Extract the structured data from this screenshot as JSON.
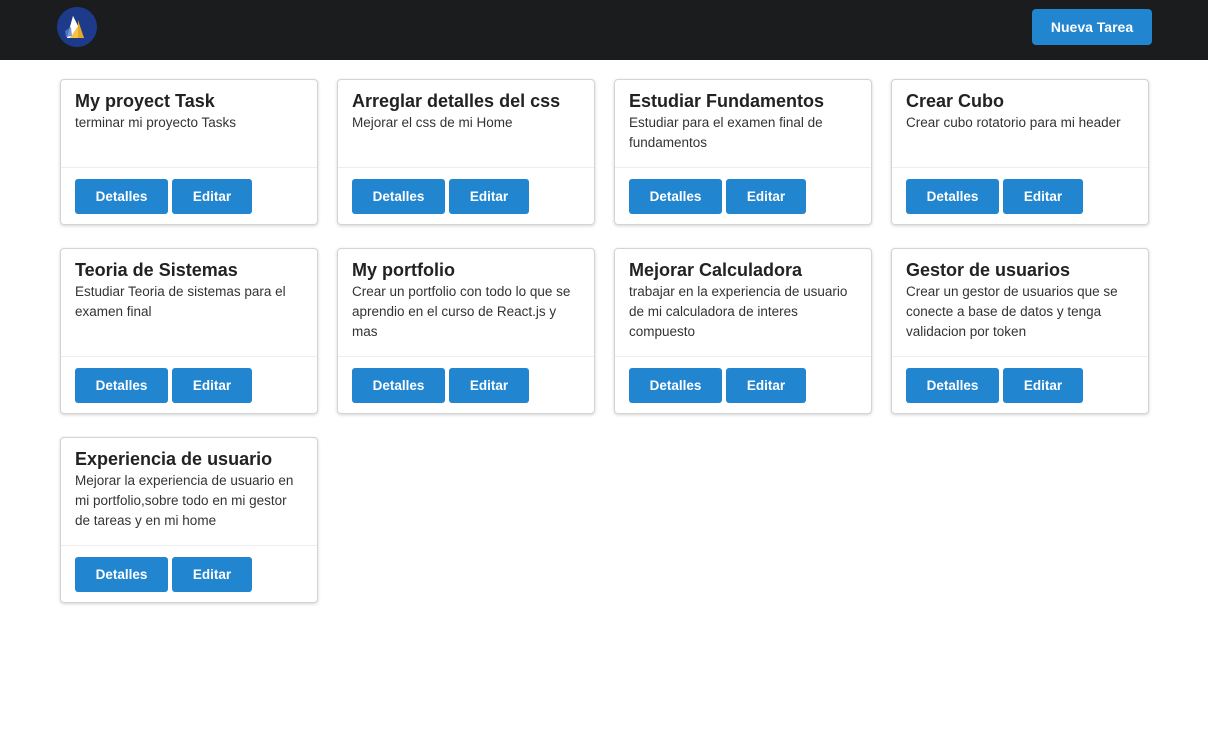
{
  "header": {
    "logo_icon": "app-logo-icon",
    "new_task_label": "Nueva Tarea",
    "background_color": "#1b1c1d",
    "accent_color": "#2185d0"
  },
  "card_actions": {
    "details_label": "Detalles",
    "edit_label": "Editar"
  },
  "tasks": [
    {
      "title": "My proyect Task",
      "description": "terminar mi proyecto Tasks"
    },
    {
      "title": "Arreglar detalles del css",
      "description": "Mejorar el css de mi Home"
    },
    {
      "title": "Estudiar Fundamentos",
      "description": "Estudiar para el examen final de fundamentos"
    },
    {
      "title": "Crear Cubo",
      "description": "Crear cubo rotatorio para mi header"
    },
    {
      "title": "Teoria de Sistemas",
      "description": "Estudiar Teoria de sistemas para el examen final"
    },
    {
      "title": "My portfolio",
      "description": "Crear un portfolio con todo lo que se aprendio en el curso de React.js y mas"
    },
    {
      "title": "Mejorar Calculadora",
      "description": "trabajar en la experiencia de usuario de mi calculadora de interes compuesto"
    },
    {
      "title": "Gestor de usuarios",
      "description": "Crear un gestor de usuarios que se conecte a base de datos y tenga validacion por token"
    },
    {
      "title": "Experiencia de usuario",
      "description": "Mejorar la experiencia de usuario en mi portfolio,sobre todo en mi gestor de tareas y en mi home"
    }
  ]
}
